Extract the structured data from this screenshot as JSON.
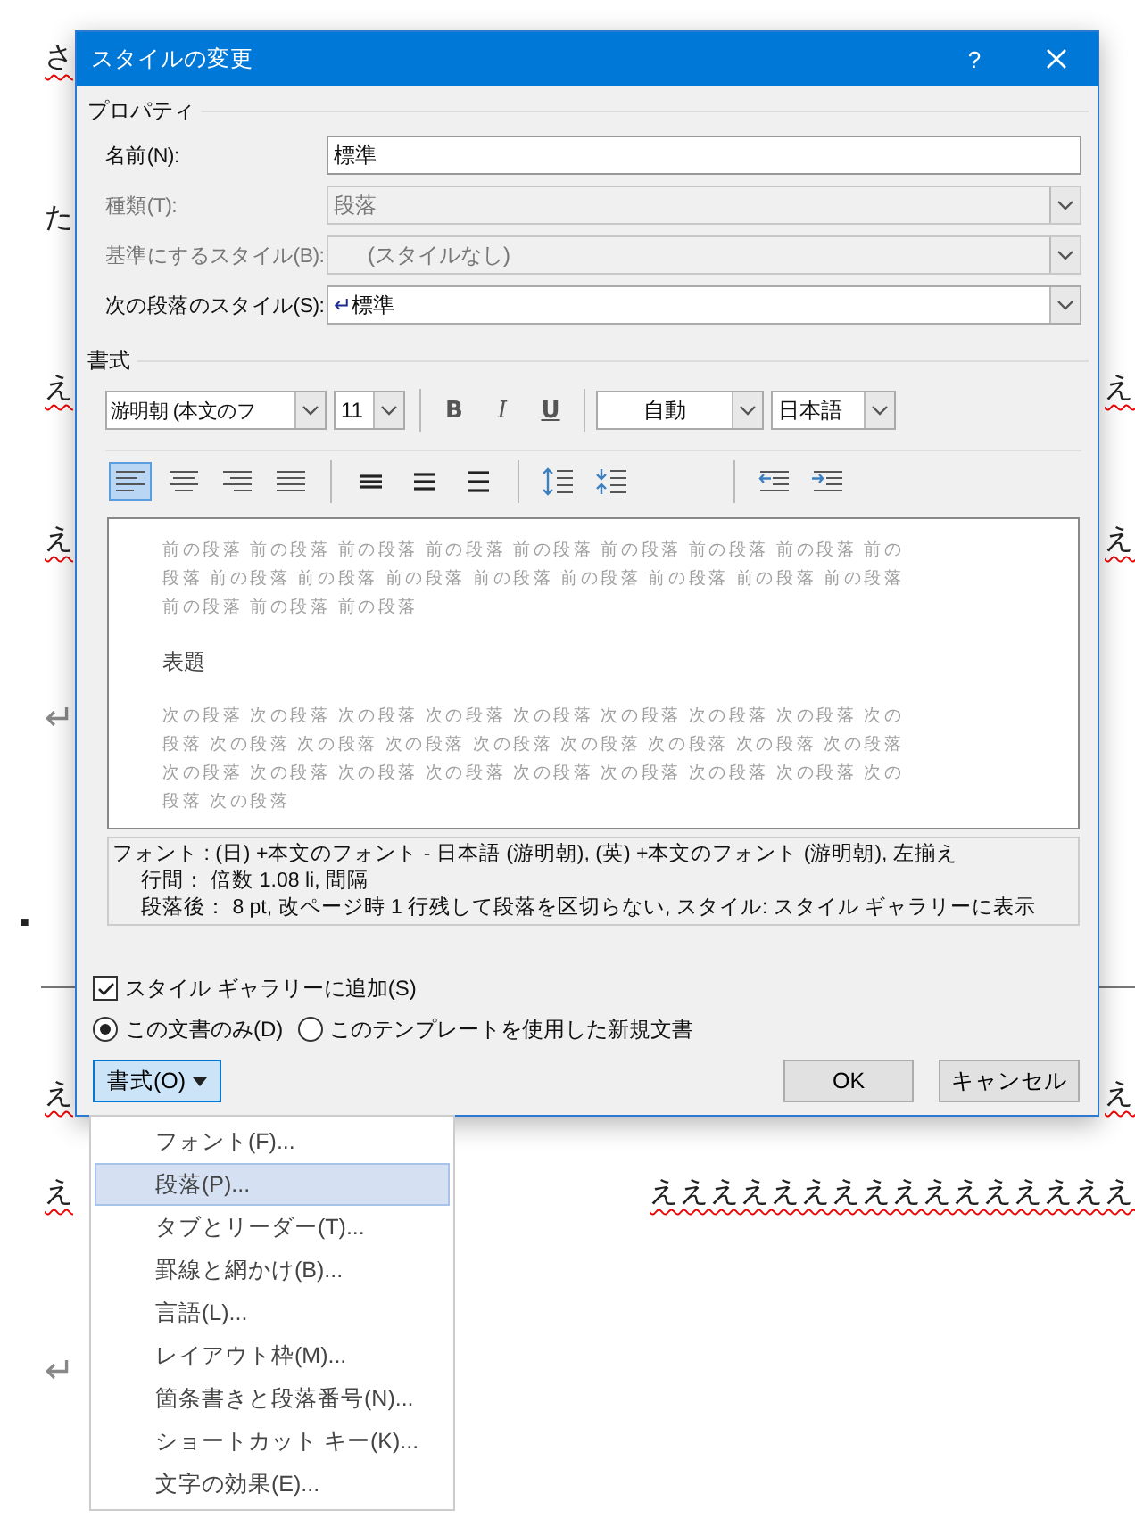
{
  "document": {
    "lines": [
      {
        "kind": "text",
        "left": "さ",
        "spell": true
      },
      {
        "kind": "text",
        "left": "た",
        "spell": false
      },
      {
        "kind": "text",
        "left": "え",
        "right": "え",
        "spell": true
      },
      {
        "kind": "text",
        "left": "え",
        "right": "え",
        "spell": true
      },
      {
        "kind": "mark",
        "left": "↵",
        "spell": false
      },
      {
        "kind": "heading",
        "left": "▪",
        "spell": false
      },
      {
        "kind": "rule"
      },
      {
        "kind": "text",
        "left": "え",
        "right": "え",
        "spell": true
      },
      {
        "kind": "text",
        "left": "え",
        "right": "ええええええええええええええええ",
        "spell": true
      },
      {
        "kind": "mark",
        "left": "↵",
        "spell": false
      }
    ]
  },
  "dialog": {
    "title": "スタイルの変更",
    "help": "?",
    "properties": {
      "legend": "プロパティ",
      "fields": [
        {
          "label": "名前(N):",
          "value": "標準",
          "kind": "text",
          "disabled": false
        },
        {
          "label": "種類(T):",
          "value": "段落",
          "kind": "combo",
          "disabled": true
        },
        {
          "label": "基準にするスタイル(B):",
          "value": "(スタイルなし)",
          "kind": "combo",
          "disabled": true
        },
        {
          "label": "次の段落のスタイル(S):",
          "value": "標準",
          "kind": "combo",
          "disabled": false,
          "mark": "↵"
        }
      ]
    },
    "format": {
      "legend": "書式",
      "font": "游明朝 (本文のフ",
      "size": "11",
      "bold": "B",
      "italic": "I",
      "underline": "U",
      "text_color_option": "自動",
      "language": "日本語",
      "paragraph_tools": [
        {
          "kind": "align-left",
          "selected": true
        },
        {
          "kind": "align-center",
          "selected": false
        },
        {
          "kind": "align-right",
          "selected": false
        },
        {
          "kind": "justify",
          "selected": false
        },
        {
          "kind": "sep"
        },
        {
          "kind": "spacing-single",
          "selected": false
        },
        {
          "kind": "spacing-1-5",
          "selected": false
        },
        {
          "kind": "spacing-double",
          "selected": false
        },
        {
          "kind": "sep"
        },
        {
          "kind": "space-increase",
          "selected": false
        },
        {
          "kind": "space-decrease",
          "selected": false
        },
        {
          "kind": "gap"
        },
        {
          "kind": "sep"
        },
        {
          "kind": "indent-decrease",
          "selected": false
        },
        {
          "kind": "indent-increase",
          "selected": false
        }
      ]
    },
    "preview": {
      "previous": [
        "前の段落 前の段落 前の段落 前の段落 前の段落 前の段落 前の段落 前の段落 前の",
        "段落 前の段落 前の段落 前の段落 前の段落 前の段落 前の段落 前の段落 前の段落",
        "前の段落 前の段落 前の段落"
      ],
      "sample": "表題",
      "next": [
        "次の段落 次の段落 次の段落 次の段落 次の段落 次の段落 次の段落 次の段落 次の",
        "段落 次の段落 次の段落 次の段落 次の段落 次の段落 次の段落 次の段落 次の段落",
        "次の段落 次の段落 次の段落 次の段落 次の段落 次の段落 次の段落 次の段落 次の",
        "段落 次の段落"
      ]
    },
    "description": [
      "フォント : (日) +本文のフォント - 日本語 (游明朝), (英) +本文のフォント (游明朝), 左揃え",
      "行間： 倍数 1.08 li, 間隔",
      "段落後： 8 pt, 改ページ時 1 行残して段落を区切らない, スタイル: スタイル ギャラリーに表示"
    ],
    "gallery": {
      "label": "スタイル ギャラリーに追加(S)",
      "checked": true
    },
    "scope": [
      {
        "label": "この文書のみ(D)",
        "selected": true
      },
      {
        "label": "このテンプレートを使用した新規文書",
        "selected": false
      }
    ],
    "format_button": "書式(O)",
    "ok": "OK",
    "cancel": "キャンセル"
  },
  "menu": {
    "items": [
      {
        "label": "フォント(F)...",
        "selected": false
      },
      {
        "label": "段落(P)...",
        "selected": true
      },
      {
        "label": "タブとリーダー(T)...",
        "selected": false
      },
      {
        "label": "罫線と網かけ(B)...",
        "selected": false
      },
      {
        "label": "言語(L)...",
        "selected": false
      },
      {
        "label": "レイアウト枠(M)...",
        "selected": false
      },
      {
        "label": "箇条書きと段落番号(N)...",
        "selected": false
      },
      {
        "label": "ショートカット キー(K)...",
        "selected": false
      },
      {
        "label": "文字の効果(E)...",
        "selected": false
      }
    ]
  }
}
